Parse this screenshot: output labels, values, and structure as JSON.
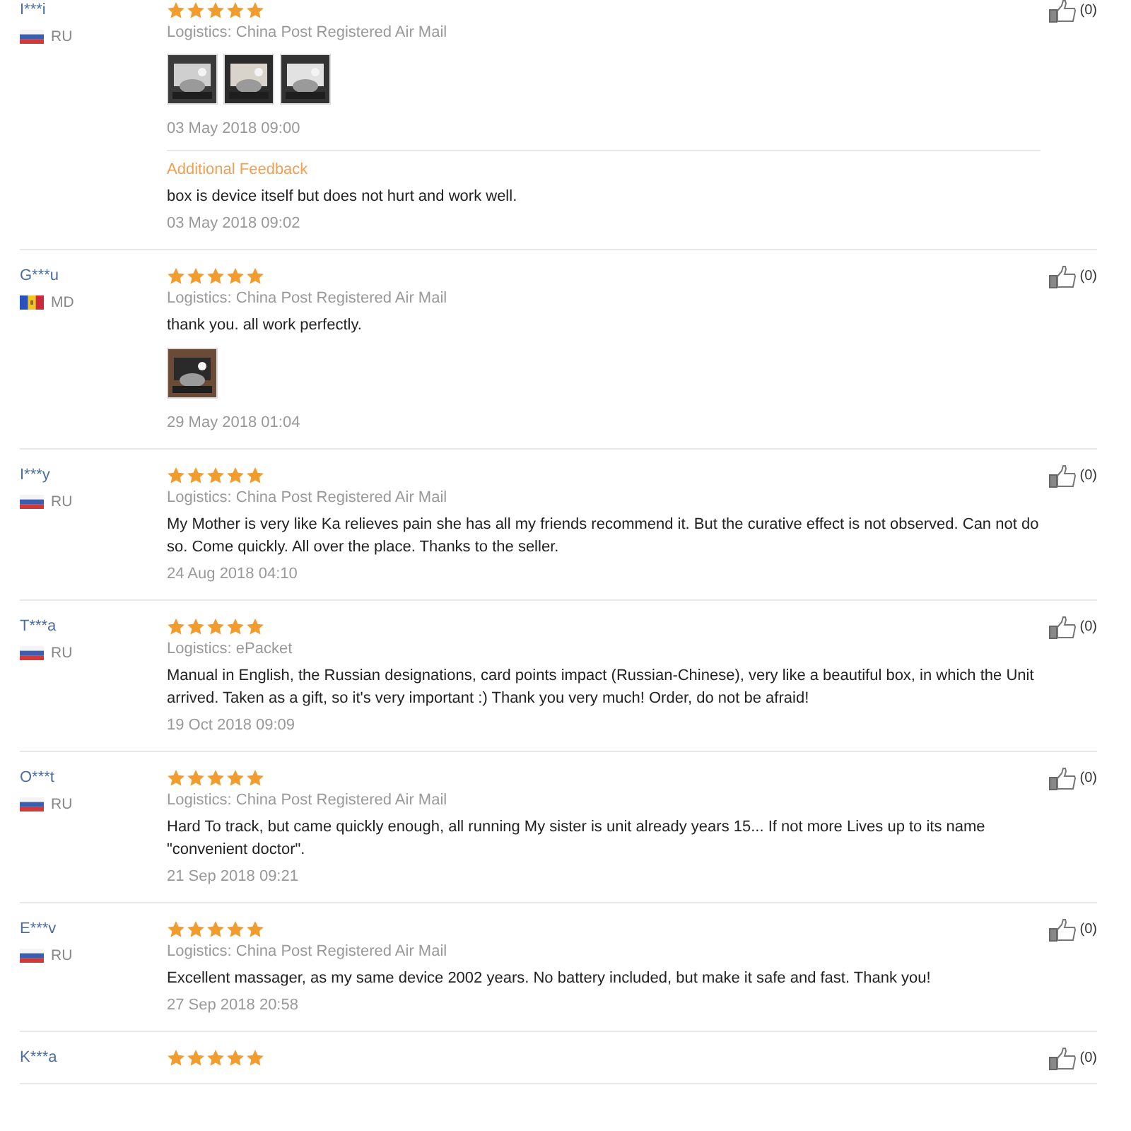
{
  "reviews": [
    {
      "user": "I***i",
      "flag": {
        "kind": "ru"
      },
      "country": "RU",
      "stars": 5,
      "logistics": "Logistics: China Post Registered Air Mail",
      "photos": [
        {
          "kind": "picture"
        },
        {
          "kind": "picture"
        },
        {
          "kind": "picture"
        }
      ],
      "date": "03 May 2018 09:00",
      "additional": {
        "label": "Additional Feedback",
        "text": "box is device itself but does not hurt and work well.",
        "date": "03 May 2018 09:02"
      },
      "likes": "(0)"
    },
    {
      "user": "G***u",
      "flag": {
        "kind": "md"
      },
      "country": "MD",
      "stars": 5,
      "logistics": "Logistics: China Post Registered Air Mail",
      "text": "thank you. all work perfectly.",
      "photos": [
        {
          "kind": "picture"
        }
      ],
      "date": "29 May 2018 01:04",
      "likes": "(0)"
    },
    {
      "user": "I***y",
      "flag": {
        "kind": "ru"
      },
      "country": "RU",
      "stars": 5,
      "logistics": "Logistics: China Post Registered Air Mail",
      "text": "My Mother is very like Ka relieves pain she has all my friends recommend it. But the curative effect is not observed. Can not do so. Come quickly. All over the place. Thanks to the seller.",
      "date": "24 Aug 2018 04:10",
      "likes": "(0)"
    },
    {
      "user": "T***a",
      "flag": {
        "kind": "ru"
      },
      "country": "RU",
      "stars": 5,
      "logistics": "Logistics: ePacket",
      "text": "Manual in English, the Russian designations, card points impact (Russian-Chinese), very like a beautiful box, in which the Unit arrived. Taken as a gift, so it's very important :) Thank you very much! Order, do not be afraid!",
      "date": "19 Oct 2018 09:09",
      "likes": "(0)"
    },
    {
      "user": "O***t",
      "flag": {
        "kind": "ru"
      },
      "country": "RU",
      "stars": 5,
      "logistics": "Logistics: China Post Registered Air Mail",
      "text": "Hard To track, but came quickly enough, all running My sister is unit already years 15...  If not more Lives up to its name \"convenient doctor\".",
      "date": "21 Sep 2018 09:21",
      "likes": "(0)"
    },
    {
      "user": "E***v",
      "flag": {
        "kind": "ru"
      },
      "country": "RU",
      "stars": 5,
      "logistics": "Logistics: China Post Registered Air Mail",
      "text": "Excellent massager, as my same device 2002 years. No battery included, but make it safe and fast. Thank you!",
      "date": "27 Sep 2018 20:58",
      "likes": "(0)"
    },
    {
      "user": "K***a",
      "stars": 5,
      "likes": "(0)"
    }
  ]
}
